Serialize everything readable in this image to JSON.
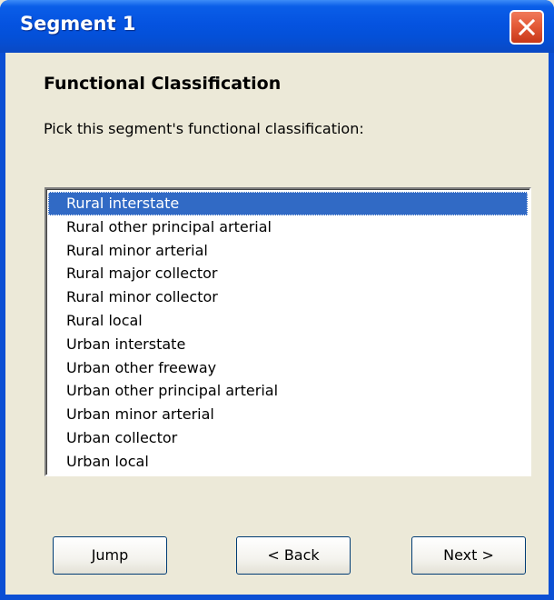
{
  "window": {
    "title": "Segment 1",
    "colors": {
      "titlebar": "#0553e0",
      "client_bg": "#ece9d8",
      "selection": "#316ac5",
      "close_button": "#e45a38"
    }
  },
  "close_icon": "close-icon",
  "heading": "Functional Classification",
  "prompt": "Pick this segment's functional classification:",
  "classification_list": {
    "selected": "Rural interstate",
    "items": [
      "Rural interstate",
      "Rural other principal arterial",
      "Rural minor arterial",
      "Rural major collector",
      "Rural minor collector",
      "Rural local",
      "Urban interstate",
      "Urban other freeway",
      "Urban other principal arterial",
      "Urban minor arterial",
      "Urban collector",
      "Urban local"
    ]
  },
  "buttons": {
    "jump": "Jump",
    "back": "< Back",
    "next": "Next >"
  }
}
